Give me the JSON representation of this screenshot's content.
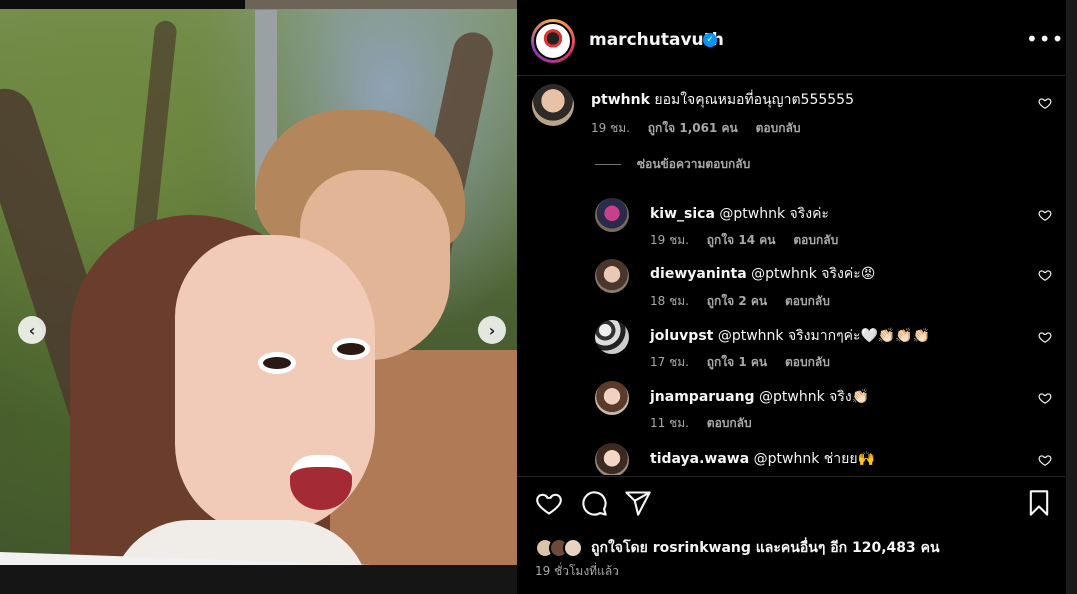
{
  "post": {
    "author": "marchutavuth",
    "verified": true,
    "more_icon": "more-horizontal-icon"
  },
  "carousel": {
    "prev_icon": "chevron-left-icon",
    "next_icon": "chevron-right-icon",
    "prev_glyph": "‹",
    "next_glyph": "›"
  },
  "comments": {
    "hide_replies_label": "ซ่อนข้อความตอบกลับ",
    "main": {
      "user": "ptwhnk",
      "text": "ยอมใจคุณหมอที่อนุญาต555555",
      "time": "19 ชม.",
      "likes": "ถูกใจ 1,061 คน",
      "reply_label": "ตอบกลับ"
    },
    "replies": [
      {
        "user": "kiw_sica",
        "text": "@ptwhnk จริงค่ะ",
        "time": "19 ชม.",
        "likes": "ถูกใจ 14 คน",
        "reply_label": "ตอบกลับ"
      },
      {
        "user": "diewyaninta",
        "text": "@ptwhnk จริงค่ะ😡",
        "time": "18 ชม.",
        "likes": "ถูกใจ 2 คน",
        "reply_label": "ตอบกลับ"
      },
      {
        "user": "joluvpst",
        "text": "@ptwhnk จริงมากๆค่ะ🤍👏🏻👏🏻👏🏻",
        "time": "17 ชม.",
        "likes": "ถูกใจ 1 คน",
        "reply_label": "ตอบกลับ"
      },
      {
        "user": "jnamparuang",
        "text": "@ptwhnk จริง👏🏻",
        "time": "11 ชม.",
        "likes": "",
        "reply_label": "ตอบกลับ"
      },
      {
        "user": "tidaya.wawa",
        "text": "@ptwhnk ช่ายย🙌",
        "time": "",
        "likes": "",
        "reply_label": ""
      }
    ]
  },
  "actions": {
    "like_icon": "heart-icon",
    "comment_icon": "comment-icon",
    "share_icon": "share-icon",
    "save_icon": "bookmark-icon"
  },
  "likes_summary": {
    "prefix": "ถูกใจโดย",
    "user": "rosrinkwang",
    "suffix": "และคนอื่นๆ อีก 120,483 คน"
  },
  "time_ago": "19 ชั่วโมงที่แล้ว",
  "colors": {
    "background": "#000000",
    "text": "#f5f5f5",
    "muted": "#a8a8a8",
    "verified": "#0095f6",
    "divider": "#262626"
  }
}
